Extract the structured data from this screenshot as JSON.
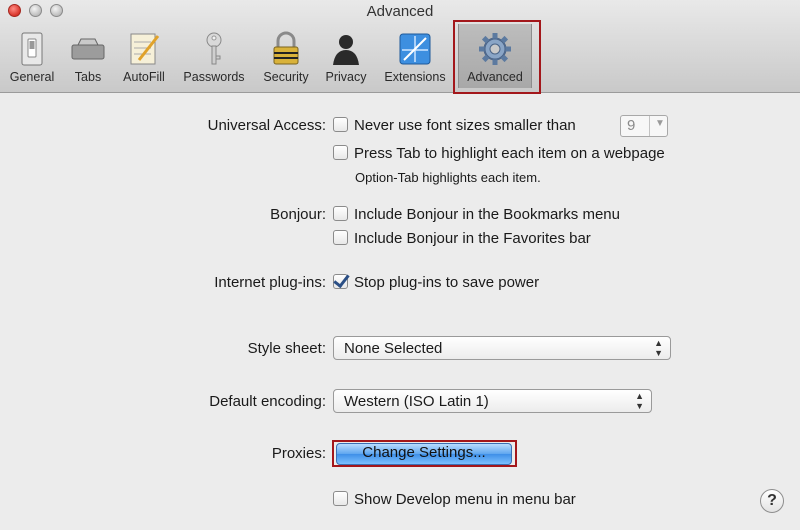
{
  "window": {
    "title": "Advanced"
  },
  "toolbar": {
    "items": [
      {
        "label": "General",
        "icon": "switch-icon"
      },
      {
        "label": "Tabs",
        "icon": "tabs-icon"
      },
      {
        "label": "AutoFill",
        "icon": "autofill-icon"
      },
      {
        "label": "Passwords",
        "icon": "key-icon"
      },
      {
        "label": "Security",
        "icon": "lock-icon"
      },
      {
        "label": "Privacy",
        "icon": "person-icon"
      },
      {
        "label": "Extensions",
        "icon": "puzzle-icon"
      },
      {
        "label": "Advanced",
        "icon": "gear-icon",
        "selected": true
      }
    ]
  },
  "universal_access": {
    "label": "Universal Access:",
    "min_font_label": "Never use font sizes smaller than",
    "min_font_checked": false,
    "min_font_value": "9",
    "tab_label": "Press Tab to highlight each item on a webpage",
    "tab_checked": false,
    "tab_note": "Option-Tab highlights each item."
  },
  "bonjour": {
    "label": "Bonjour:",
    "bookmarks_label": "Include Bonjour in the Bookmarks menu",
    "bookmarks_checked": false,
    "favorites_label": "Include Bonjour in the Favorites bar",
    "favorites_checked": false
  },
  "plugins": {
    "label": "Internet plug-ins:",
    "stop_label": "Stop plug-ins to save power",
    "stop_checked": true
  },
  "style_sheet": {
    "label": "Style sheet:",
    "value": "None Selected"
  },
  "encoding": {
    "label": "Default encoding:",
    "value": "Western (ISO Latin 1)"
  },
  "proxies": {
    "label": "Proxies:",
    "button_label": "Change Settings..."
  },
  "develop": {
    "label": "Show Develop menu in menu bar",
    "checked": false
  },
  "help": {
    "label": "?"
  },
  "colors": {
    "highlight": "#a3171b",
    "accent": "#3f8fe8"
  }
}
